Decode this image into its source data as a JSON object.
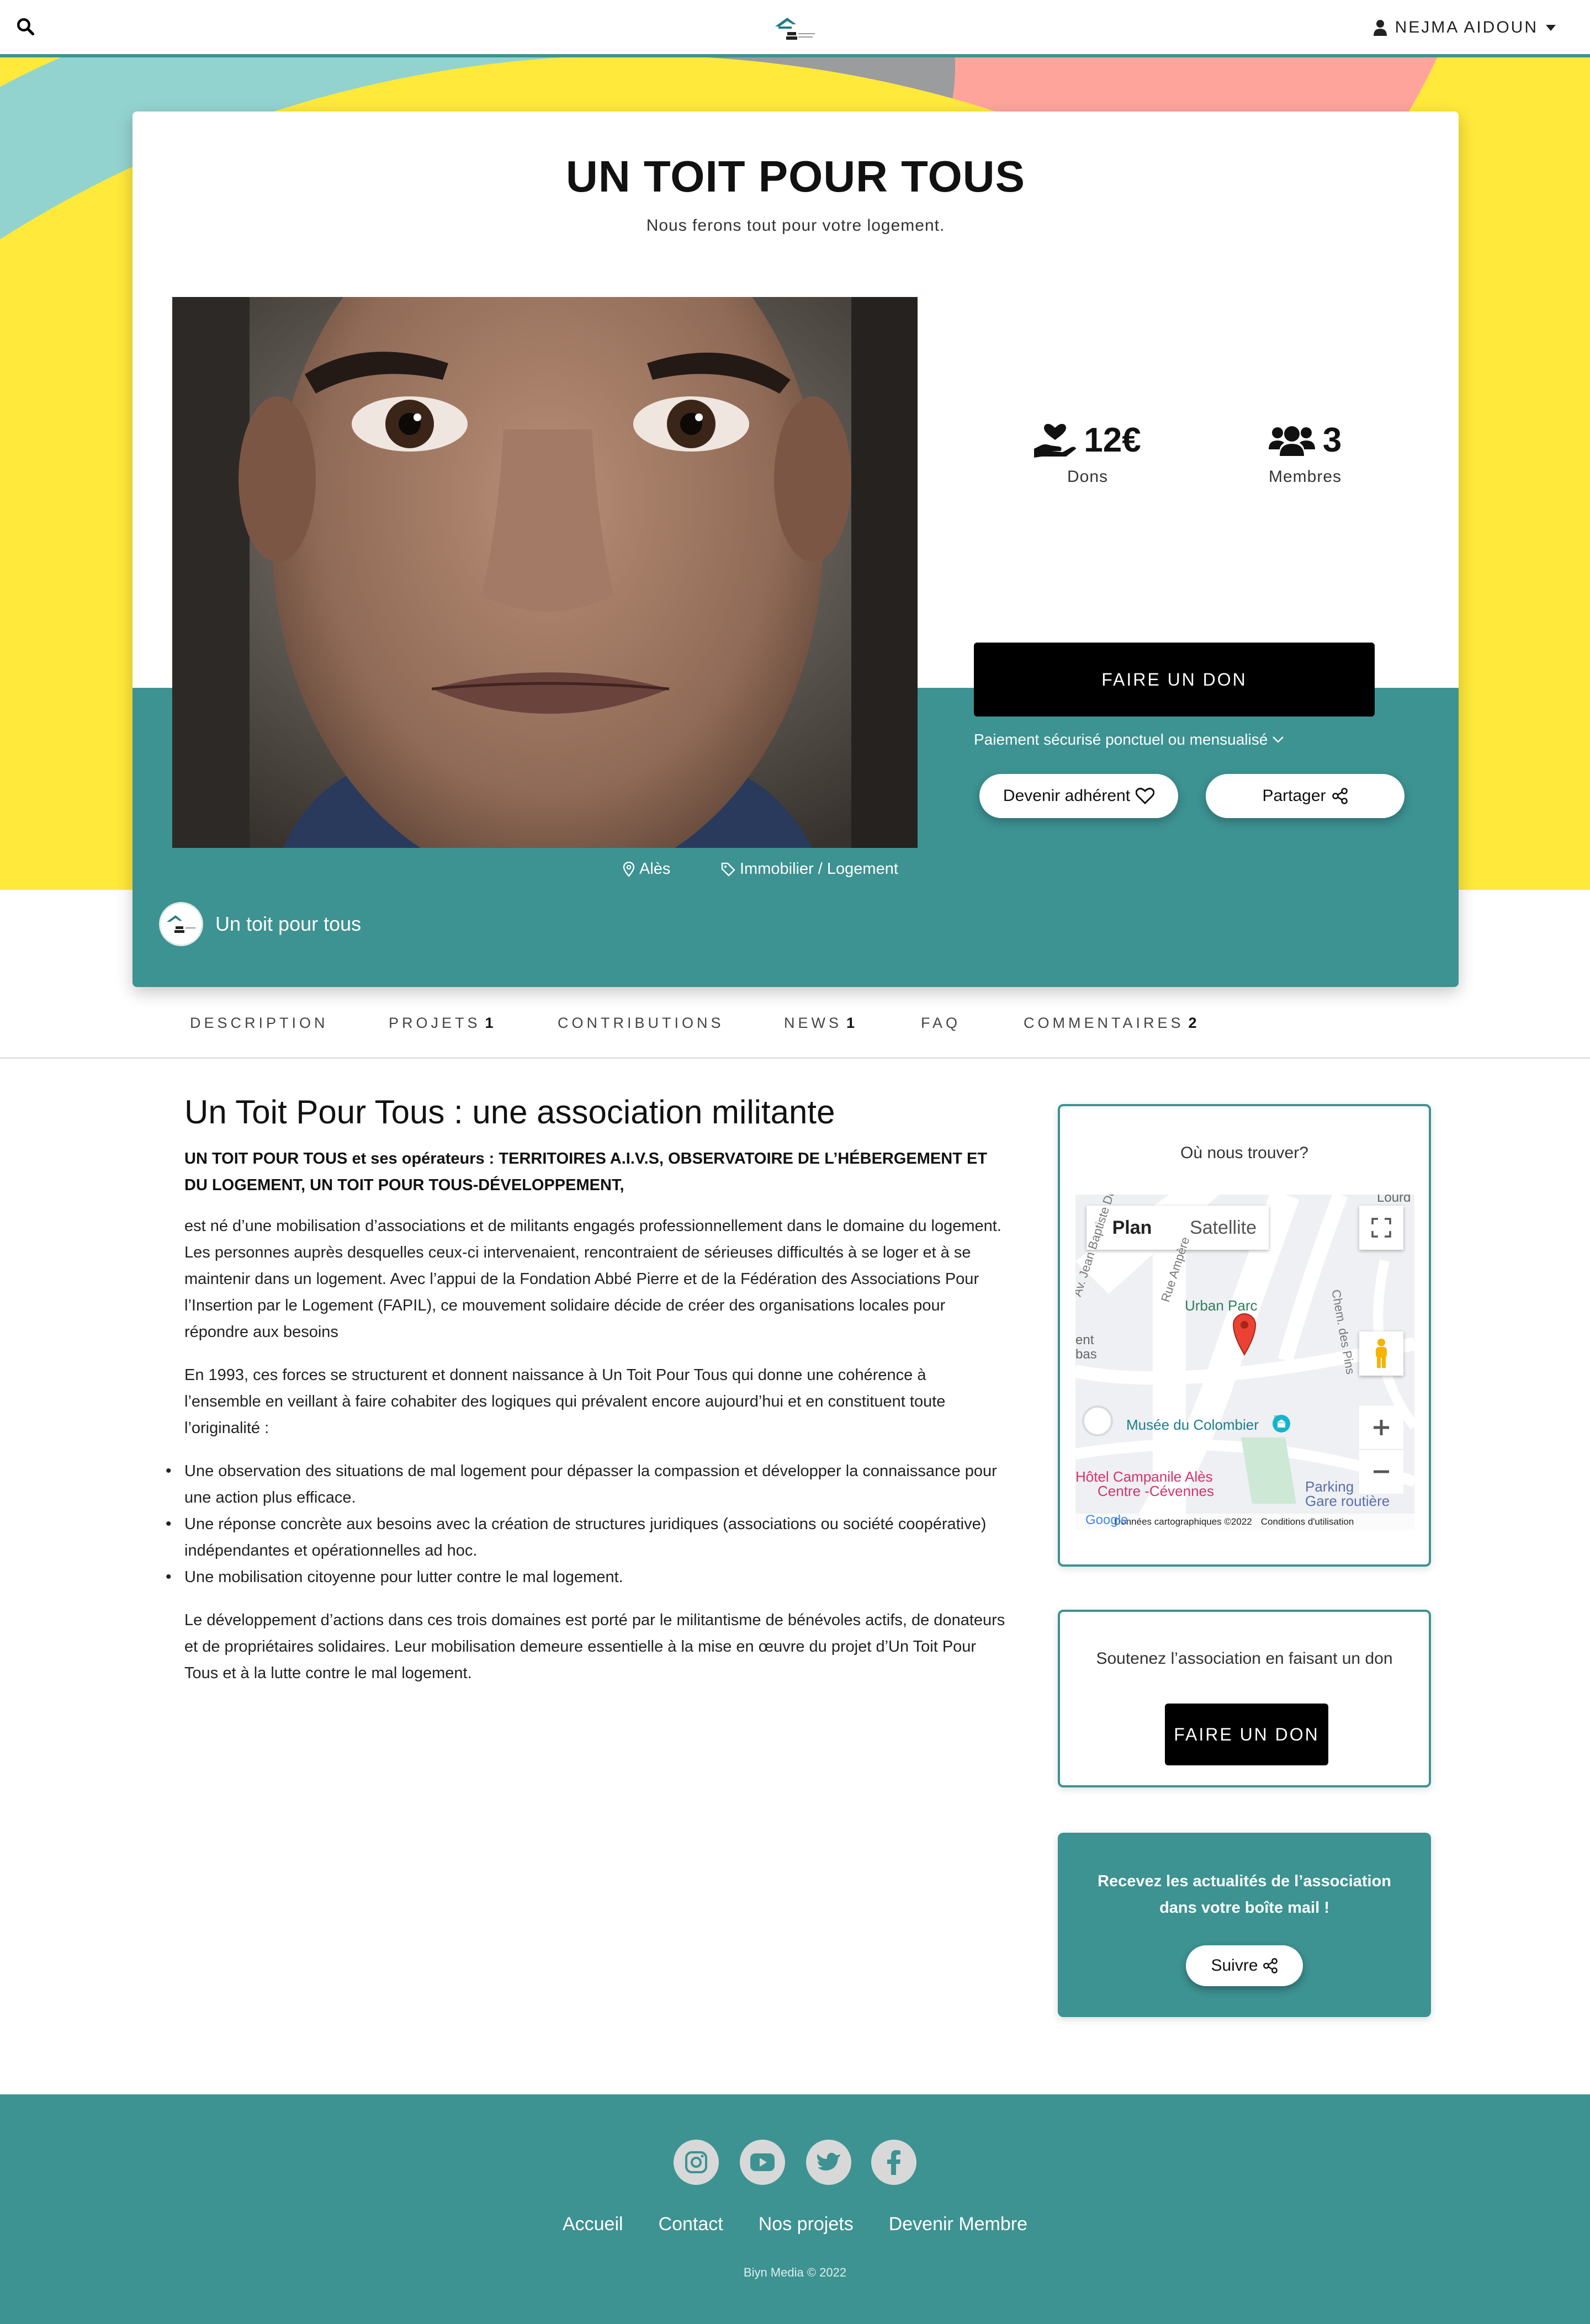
{
  "header": {
    "user_name": "NEJMA AIDOUN"
  },
  "association": {
    "title": "UN TOIT POUR TOUS",
    "slogan": "Nous ferons tout pour votre logement.",
    "stats": [
      {
        "value": "12€",
        "label": "Dons"
      },
      {
        "value": "3",
        "label": "Membres"
      }
    ],
    "donate_label": "FAIRE UN DON",
    "secure_payment": "Paiement sécurisé ponctuel ou mensualisé",
    "join_label": "Devenir adhérent",
    "share_label": "Partager",
    "location": "Alès",
    "category": "Immobilier / Logement",
    "org_name": "Un toit pour tous"
  },
  "tabs": [
    {
      "label": "DESCRIPTION",
      "count": ""
    },
    {
      "label": "PROJETS",
      "count": "1"
    },
    {
      "label": "CONTRIBUTIONS",
      "count": ""
    },
    {
      "label": "NEWS",
      "count": "1"
    },
    {
      "label": "FAQ",
      "count": ""
    },
    {
      "label": "COMMENTAIRES",
      "count": "2"
    }
  ],
  "article": {
    "heading": "Un Toit Pour Tous : une association militante",
    "lead": "UN TOIT POUR TOUS et ses opérateurs : TERRITOIRES A.I.V.S, OBSERVATOIRE DE L’HÉBERGEMENT ET DU LOGEMENT, UN TOIT POUR TOUS-DÉVELOPPEMENT,",
    "p1": "est né d’une mobilisation d’associations et de militants engagés professionnellement dans le domaine du logement. Les personnes auprès desquelles ceux-ci intervenaient, rencontraient de sérieuses difficultés à se loger et à se maintenir dans un logement. Avec l’appui de la Fondation Abbé Pierre et de la Fédération des Associations Pour l’Insertion par le Logement (FAPIL), ce mouvement solidaire décide de créer des organisations locales pour répondre aux besoins",
    "p2": "En 1993, ces forces se structurent et donnent naissance à Un Toit Pour Tous qui donne une cohérence à l’ensemble en veillant à faire cohabiter des logiques qui prévalent encore aujourd’hui et en constituent toute l’originalité :",
    "bullets": [
      "Une observation des situations de mal logement pour dépasser la compassion et développer la connaissance pour une action plus efficace.",
      "Une réponse concrète aux besoins avec la création de structures juridiques (associations ou société coopérative) indépendantes et opérationnelles ad hoc.",
      "Une mobilisation citoyenne pour lutter contre le mal logement."
    ],
    "p3": "Le développement d’actions dans ces trois domaines est porté par le militantisme de bénévoles actifs, de donateurs et de propriétaires solidaires. Leur mobilisation demeure essentielle à la mise en œuvre du projet d’Un Toit Pour Tous et à la lutte contre le mal logement."
  },
  "sidebar": {
    "map_title": "Où nous trouver?",
    "map": {
      "plan": "Plan",
      "satellite": "Satellite",
      "labels": {
        "lourd": "Lourd",
        "street1": "Av. Jean Baptiste Dumas",
        "street2": "Rue Ampère",
        "park": "Urban Parc",
        "chemin": "Chem. des Pins",
        "ent": "ent",
        "bas": "bas",
        "musee": "Musée du Colombier",
        "hotel1": "Hôtel Campanile Alès",
        "hotel2": "Centre -Cévennes",
        "parking1": "Parking",
        "parking2": "Gare routière",
        "google": "Google",
        "data": "Données cartographiques ©2022",
        "terms": "Conditions d'utilisation"
      }
    },
    "donate_text": "Soutenez l’association en faisant un don",
    "donate_label": "FAIRE UN DON",
    "news_text": "Recevez les actualités de l’association dans votre boîte mail !",
    "follow_label": "Suivre"
  },
  "footer": {
    "social": [
      "instagram-icon",
      "youtube-icon",
      "twitter-icon",
      "facebook-icon"
    ],
    "links": [
      "Accueil",
      "Contact",
      "Nos projets",
      "Devenir Membre"
    ],
    "copyright": "Biyn Media © 2022"
  },
  "colors": {
    "teal": "#3d9292",
    "yellow": "#ffe93a",
    "salmon": "#ffa49b",
    "mint": "#93d3cf"
  }
}
